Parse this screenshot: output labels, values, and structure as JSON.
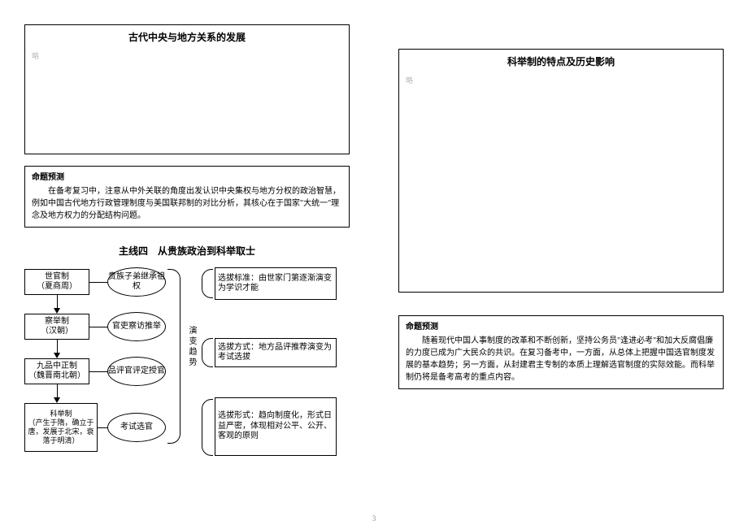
{
  "left": {
    "box_title": "古代中央与地方关系的发展",
    "box_mark": "略",
    "prediction": {
      "title": "命题预测",
      "body": "在备考复习中，注意从中外关联的角度出发认识中央集权与地方分权的政治智慧，例如中国古代地方行政管理制度与美国联邦制的对比分析，其核心在于国家\"大统一\"理念及地方权力的分配结构问题。"
    },
    "thread_title": "主线四　从贵族政治到科举取士",
    "diagram": {
      "col1": [
        {
          "l1": "世官制",
          "l2": "（夏商周）"
        },
        {
          "l1": "察举制",
          "l2": "（汉朝）"
        },
        {
          "l1": "九品中正制",
          "l2": "（魏晋南北朝）"
        },
        {
          "l1": "科举制",
          "l2": "（产生于隋，确立于唐，发展于北宋，衰落于明清）"
        }
      ],
      "col2": [
        "贵族子弟继承祖权",
        "官吏察访推举",
        "品评官评定授官",
        "考试选官"
      ],
      "axis": "演变趋势",
      "col3": [
        "选拔标准：由世家门第逐渐演变为学识才能",
        "选拔方式：地方品评推荐演变为考试选拔",
        "选拔形式：趋向制度化，形式日益严密，体现相对公平、公开、客观的原则"
      ]
    }
  },
  "right": {
    "box_title": "科举制的特点及历史影响",
    "box_mark": "略",
    "prediction": {
      "title": "命题预测",
      "body": "随着现代中国人事制度的改革和不断创新，坚持公务员\"逢进必考\"和加大反腐倡廉的力度已成为广大民众的共识。在复习备考中，一方面，从总体上把握中国选官制度发展的基本趋势；另一方面，从封建君主专制的本质上理解选官制度的实际效能。而科举制仍将是备考高考的重点内容。"
    }
  },
  "page_number": "3"
}
